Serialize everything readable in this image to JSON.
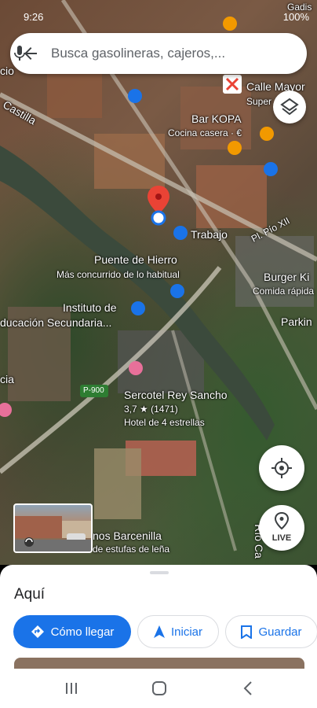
{
  "status_bar": {
    "time": "9:26",
    "battery": "100%"
  },
  "search": {
    "placeholder": "Busca gasolineras, cajeros,..."
  },
  "map_labels": {
    "poi_1": "Calle Mayor",
    "poi_2": "Super",
    "bar_kopa": "Bar KOPA",
    "bar_kopa_sub": "Cocina casera · €",
    "trabajo": "Trabajo",
    "plaza": "Pl. Pío XII",
    "puente": "Puente de Hierro",
    "puente_sub": "Más concurrido de lo habitual",
    "instituto_1": "Instituto de",
    "instituto_2": "ducación Secundaria...",
    "burger": "Burger Ki",
    "burger_sub": "Comida rápida",
    "parking": "Parkin",
    "road_p900": "P-900",
    "hotel": "Sercotel Rey Sancho",
    "hotel_rating": "3,7 ★ (1471)",
    "hotel_sub": "Hotel de 4 estrellas",
    "barcenilla": "nos Barcenilla",
    "barcenilla_sub": "de estufas de leña",
    "rio": "Río Ca",
    "castilla": "Castilla",
    "left_1": "cio",
    "left_2": "cia",
    "top_right": "Gadis"
  },
  "buttons": {
    "layers_icon": "layers-icon",
    "locate_icon": "my-location-icon",
    "live": "LIVE"
  },
  "sheet": {
    "title": "Aquí",
    "directions": "Cómo llegar",
    "start": "Iniciar",
    "save": "Guardar"
  },
  "colors": {
    "accent": "#1a73e8",
    "pin": "#ea4335"
  }
}
